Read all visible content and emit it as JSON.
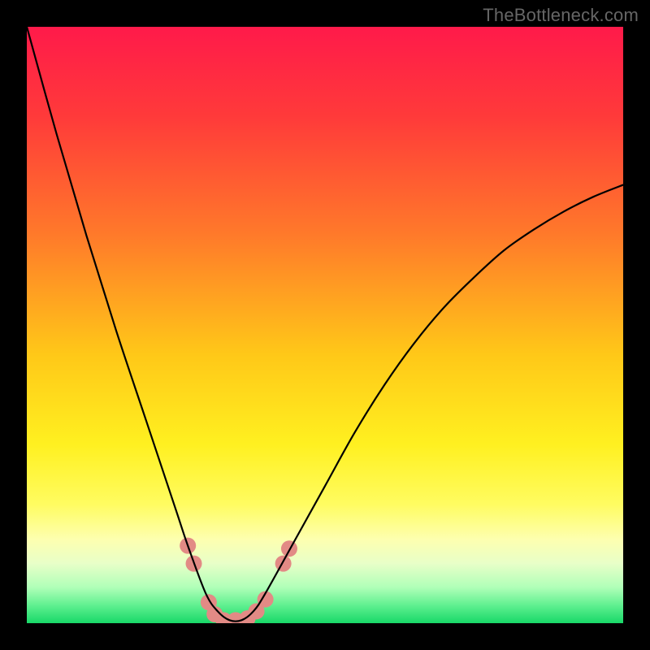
{
  "watermark": "TheBottleneck.com",
  "chart_data": {
    "type": "line",
    "title": "",
    "xlabel": "",
    "ylabel": "",
    "xlim": [
      0,
      100
    ],
    "ylim": [
      0,
      100
    ],
    "series": [
      {
        "name": "curve",
        "x": [
          0,
          5,
          10,
          15,
          20,
          25,
          27,
          30,
          32,
          34,
          36,
          38,
          40,
          45,
          50,
          55,
          60,
          65,
          70,
          75,
          80,
          85,
          90,
          95,
          100
        ],
        "y": [
          100,
          82,
          65,
          49,
          34,
          19,
          13,
          5,
          2,
          0.5,
          0.5,
          2,
          5,
          14,
          23,
          32,
          40,
          47,
          53,
          58,
          62.5,
          66,
          69,
          71.5,
          73.5
        ]
      }
    ],
    "annotations": [
      {
        "type": "marker",
        "x": 27,
        "y": 13,
        "color": "#e28a85"
      },
      {
        "type": "marker",
        "x": 28,
        "y": 10,
        "color": "#e28a85"
      },
      {
        "type": "marker",
        "x": 30.5,
        "y": 3.5,
        "color": "#e28a85"
      },
      {
        "type": "marker",
        "x": 31.5,
        "y": 1.5,
        "color": "#e28a85"
      },
      {
        "type": "marker",
        "x": 33,
        "y": 0.5,
        "color": "#e28a85"
      },
      {
        "type": "marker",
        "x": 35,
        "y": 0.5,
        "color": "#e28a85"
      },
      {
        "type": "marker",
        "x": 37,
        "y": 0.8,
        "color": "#e28a85"
      },
      {
        "type": "marker",
        "x": 38.5,
        "y": 2,
        "color": "#e28a85"
      },
      {
        "type": "marker",
        "x": 40,
        "y": 4,
        "color": "#e28a85"
      },
      {
        "type": "marker",
        "x": 43,
        "y": 10,
        "color": "#e28a85"
      },
      {
        "type": "marker",
        "x": 44,
        "y": 12.5,
        "color": "#e28a85"
      }
    ],
    "background_gradient": {
      "stops": [
        {
          "pos": 0.0,
          "color": "#ff1a4a"
        },
        {
          "pos": 0.15,
          "color": "#ff3a3a"
        },
        {
          "pos": 0.35,
          "color": "#ff7a2a"
        },
        {
          "pos": 0.55,
          "color": "#ffc818"
        },
        {
          "pos": 0.7,
          "color": "#fff020"
        },
        {
          "pos": 0.8,
          "color": "#fffc60"
        },
        {
          "pos": 0.86,
          "color": "#fdffb0"
        },
        {
          "pos": 0.9,
          "color": "#e8ffc8"
        },
        {
          "pos": 0.94,
          "color": "#b0ffb8"
        },
        {
          "pos": 0.97,
          "color": "#60f090"
        },
        {
          "pos": 1.0,
          "color": "#18d868"
        }
      ]
    }
  }
}
